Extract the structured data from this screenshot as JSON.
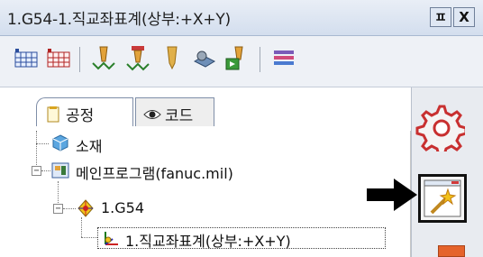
{
  "titlebar": {
    "title": "1.G54-1.직교좌표계(상부:+X+Y)",
    "pin_label": "ㅍ",
    "close_label": "X"
  },
  "toolbar": {
    "tools": [
      "grid-icon",
      "grid-red-icon",
      "toolpath-orange-icon",
      "toolpath-red-icon",
      "tool-drill-icon",
      "machine-icon",
      "simulate-icon",
      "layers-icon"
    ]
  },
  "tabs": [
    {
      "label": "공정",
      "icon": "process-icon",
      "active": true
    },
    {
      "label": "코드",
      "icon": "eye-icon",
      "active": false
    }
  ],
  "tree": {
    "items": [
      {
        "label": "소재",
        "icon": "stock-cube-icon"
      },
      {
        "label": "메인프로그램(fanuc.mil)",
        "icon": "program-icon"
      },
      {
        "label": "1.G54",
        "icon": "workcoord-icon"
      },
      {
        "label": "1.직교좌표계(상부:+X+Y)",
        "icon": "coordinate-system-icon"
      }
    ]
  },
  "colors": {
    "titlebar": "#d3deee",
    "accent_orange": "#e5632b",
    "tree_bg": "#ffffff",
    "selection_border": "#111111"
  }
}
